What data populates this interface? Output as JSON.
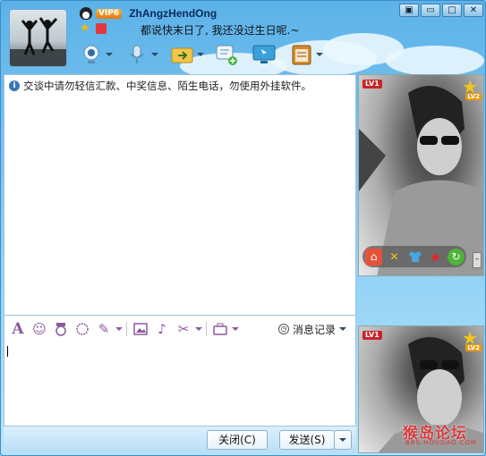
{
  "header": {
    "vip_label": "VIP6",
    "username": "ZhAngzHendOng",
    "signature": "都说快末日了, 我还没过生日呢.~"
  },
  "toolbar": {
    "items": [
      {
        "name": "video",
        "icon": "webcam-icon"
      },
      {
        "name": "voice",
        "icon": "microphone-icon"
      },
      {
        "name": "file-transfer",
        "icon": "folder-arrow-icon"
      },
      {
        "name": "message",
        "icon": "chat-bubble-icon"
      },
      {
        "name": "remote-assist",
        "icon": "monitor-icon"
      },
      {
        "name": "apps",
        "icon": "clipboard-icon"
      }
    ]
  },
  "window_controls": {
    "pin": "▣",
    "minimize": "▭",
    "maximize": "□",
    "close": "✕"
  },
  "chat": {
    "notice": "交谈中请勿轻信汇款、中奖信息、陌生电话，勿使用外挂软件。"
  },
  "format_toolbar": {
    "history_label": "消息记录"
  },
  "buttons": {
    "close_label": "关闭(C)",
    "send_label": "发送(S)"
  },
  "profile": {
    "level_badge": "LV1",
    "level_star": "LV2"
  },
  "watermark": {
    "text": "猴岛论坛",
    "sub": "BBS.HOUDAO.COM"
  },
  "colors": {
    "accent": "#5cb2e8",
    "format_icon": "#8a5a9a"
  }
}
